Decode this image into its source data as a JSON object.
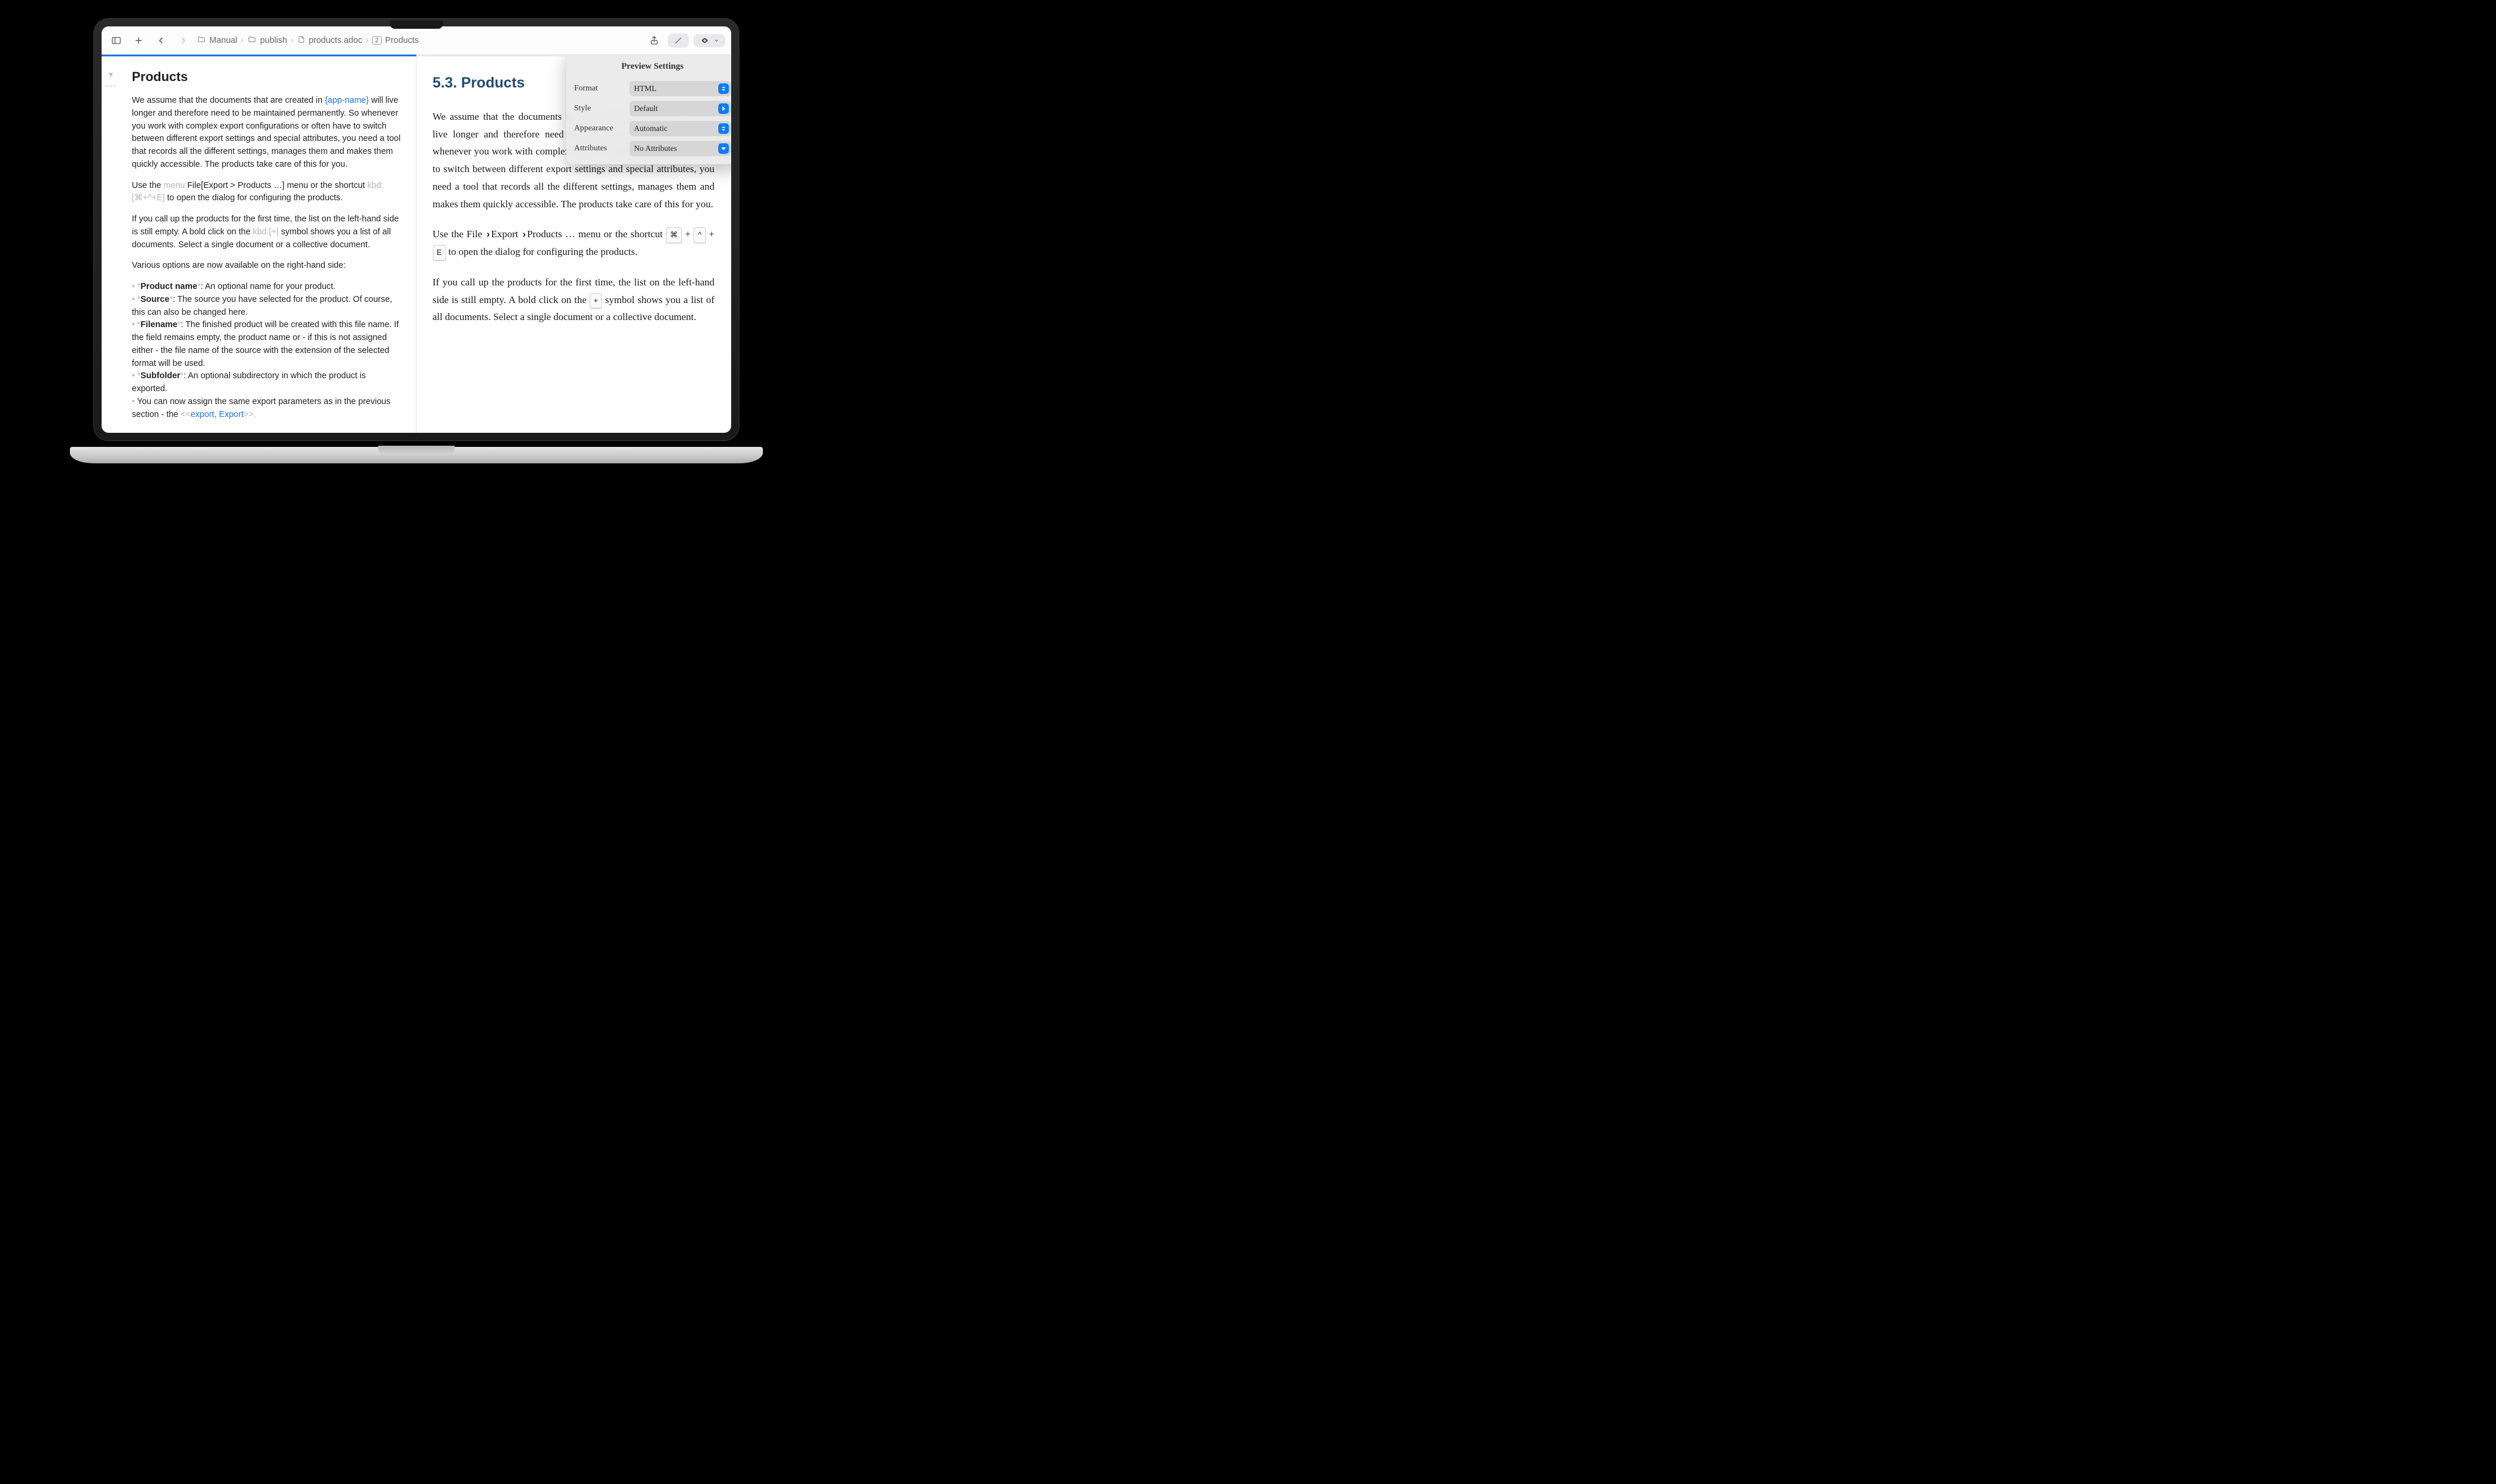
{
  "toolbar": {
    "breadcrumbs": [
      {
        "kind": "folder",
        "label": "Manual"
      },
      {
        "kind": "folder",
        "label": "publish"
      },
      {
        "kind": "doc",
        "label": "products.adoc"
      },
      {
        "kind": "heading",
        "badge": "2",
        "label": "Products"
      }
    ]
  },
  "editor": {
    "heading": "Products",
    "paragraphs": {
      "p1a": "We assume that the documents that are created in ",
      "p1_attr": "{app-name}",
      "p1b": " will live longer and therefore need to be maintained permanently. So whenever you work with complex export configurations or often have to switch between different export settings and special attributes, you need a tool that records all the different settings, manages them and makes them quickly accessible. The products take care of this for you.",
      "p2a": "Use the ",
      "p2_menu_dim": "menu:",
      "p2_menu_path": "File[Export > Products …]",
      "p2b": " menu or the shortcut ",
      "p2_kbd_dim": "kbd:[",
      "p2_kbd_keys": "⌘+^+E",
      "p2_kbd_close": "]",
      "p2c": " to open the dialog for configuring the products.",
      "p3a": "If you call up the products for the first time, the list on the left-hand side is still empty. A bold click on the ",
      "p3_kbd": "kbd:[+]",
      "p3b": " symbol shows you a list of all documents. Select a single document or a collective document.",
      "p4": "Various options are now available on the right-hand side:"
    },
    "bullets": [
      {
        "term": "Product name",
        "desc": ": An optional name for your product."
      },
      {
        "term": "Source",
        "desc": ": The source you have selected for the product. Of course, this can also be changed here."
      },
      {
        "term": "Filename",
        "desc": ": The finished product will be created with this file name. If the field remains empty, the product name or - if this is not assigned either - the file name of the source with the extension of the selected format will be used."
      },
      {
        "term": "Subfolder",
        "desc": ": An optional subdirectory in which the product is exported."
      }
    ],
    "last_bullet_a": "You can now assign the same export parameters as in the previous section - the ",
    "last_bullet_dim_open": "<<",
    "last_bullet_link": "export, Export",
    "last_bullet_dim_close": ">>.",
    "gutter_markup": "==="
  },
  "preview": {
    "heading": "5.3. Products",
    "p1": "We assume that the documents that are created in adoc Studio will live longer and therefore need to be maintained permanently. So whenever you work with complex export configurations or often have to switch between different export settings and special attributes, you need a tool that records all the different settings, manages them and makes them quickly accessible. The products take care of this for you.",
    "p2a": "Use the File ",
    "p2b": "Export ",
    "p2c": "Products … menu or the shortcut ",
    "p2_key1": "⌘",
    "p2_plus": "+",
    "p2_key2": "^",
    "p2_key3": "E",
    "p2d": " to open the dialog for configuring the products.",
    "p3a": "If you call up the products for the first time, the list on the left-hand side is still empty. A bold click on the ",
    "p3_key": "+",
    "p3b": " symbol shows you a list of all documents. Select a single document or a collective document."
  },
  "popover": {
    "title": "Preview Settings",
    "rows": [
      {
        "label": "Format",
        "value": "HTML",
        "caret": "updown"
      },
      {
        "label": "Style",
        "value": "Default",
        "caret": "right"
      },
      {
        "label": "Appearance",
        "value": "Automatic",
        "caret": "updown"
      },
      {
        "label": "Attributes",
        "value": "No Attributes",
        "caret": "down"
      }
    ]
  }
}
